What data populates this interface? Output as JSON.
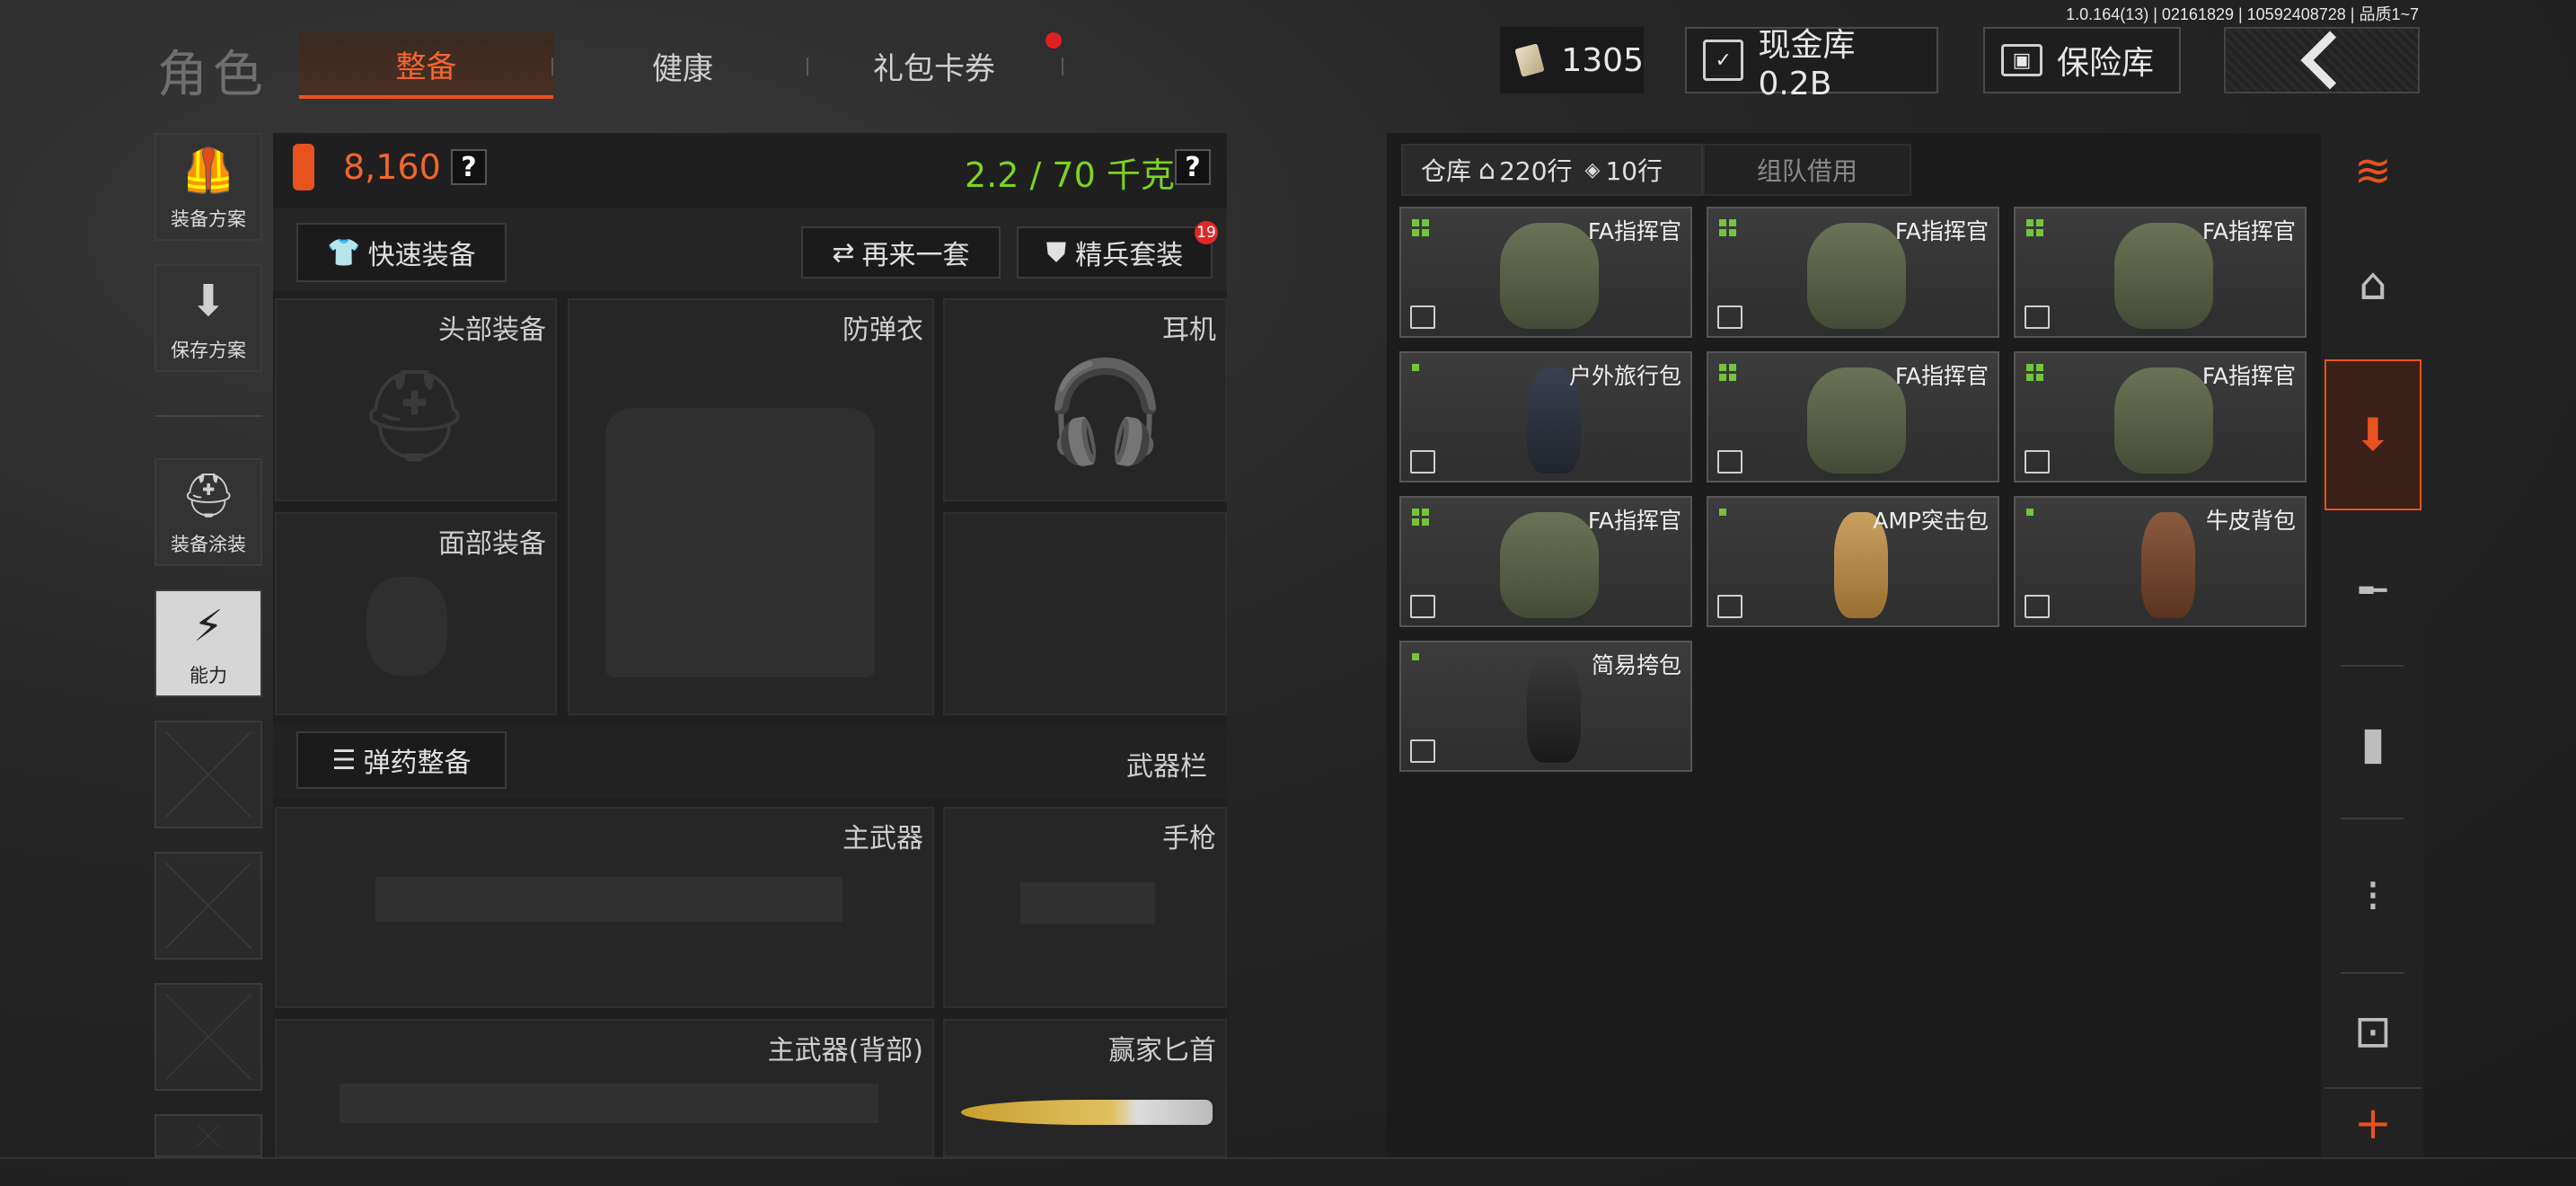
{
  "version": "1.0.164(13) | 02161829 | 10592408728 | 品质1~7",
  "header": {
    "title": "角色",
    "tabs": [
      {
        "label": "整备",
        "active": true
      },
      {
        "label": "健康",
        "active": false
      },
      {
        "label": "礼包卡券",
        "active": false,
        "dot": true
      }
    ],
    "currency": {
      "value": "1305",
      "icon": "cash-icon"
    },
    "cash_vault": {
      "label": "现金库 0.2B",
      "icon": "cash-vault-icon"
    },
    "safe": {
      "label": "保险库",
      "icon": "safe-icon"
    },
    "back_icon": "back-chevron-icon"
  },
  "left_menu": [
    {
      "label": "装备方案",
      "icon": "vest-icon"
    },
    {
      "label": "保存方案",
      "icon": "download-icon"
    },
    {
      "label": "装备涂装",
      "icon": "helmet-paint-icon"
    },
    {
      "label": "能力",
      "icon": "lightning-badge-icon",
      "selected": true
    }
  ],
  "loadout": {
    "value": "8,160",
    "weight": "2.2 / 70 千克",
    "help": "?",
    "quick_equip": "快速装备",
    "again": "再来一套",
    "elite": "精兵套装",
    "elite_badge": "19",
    "slots": {
      "head": "头部装备",
      "armor": "防弹衣",
      "headset": "耳机",
      "face": "面部装备",
      "primary": "主武器",
      "pistol": "手枪",
      "primary_back": "主武器(背部)",
      "melee": "赢家匕首"
    },
    "ammo_equip": "弹药整备",
    "weapon_bar": "武器栏"
  },
  "warehouse": {
    "tab_label": "仓库",
    "rows_home": "220行",
    "rows_tag": "10行",
    "team_borrow": "组队借用",
    "items": [
      {
        "name": "FA指挥官",
        "grade": 4,
        "color": "green"
      },
      {
        "name": "FA指挥官",
        "grade": 4,
        "color": "green"
      },
      {
        "name": "FA指挥官",
        "grade": 4,
        "color": "green"
      },
      {
        "name": "户外旅行包",
        "grade": 1,
        "color": "blue"
      },
      {
        "name": "FA指挥官",
        "grade": 4,
        "color": "green"
      },
      {
        "name": "FA指挥官",
        "grade": 4,
        "color": "green"
      },
      {
        "name": "FA指挥官",
        "grade": 4,
        "color": "green"
      },
      {
        "name": "AMP突击包",
        "grade": 1,
        "color": "tan"
      },
      {
        "name": "牛皮背包",
        "grade": 1,
        "color": "brown"
      },
      {
        "name": "简易挎包",
        "grade": 1,
        "color": "dark"
      }
    ]
  },
  "right_sidebar": [
    {
      "icon": "stack-refresh-icon"
    },
    {
      "icon": "home-icon"
    },
    {
      "icon": "backpack-icon",
      "selected": true
    },
    {
      "icon": "rifle-icon"
    },
    {
      "icon": "magazine-icon"
    },
    {
      "icon": "ammo-icon"
    },
    {
      "icon": "scope-icon"
    },
    {
      "icon": "plus-icon"
    }
  ],
  "colors": {
    "accent": "#e8521e",
    "weight_green": "#7ed321",
    "grade_green": "#74c43c"
  }
}
